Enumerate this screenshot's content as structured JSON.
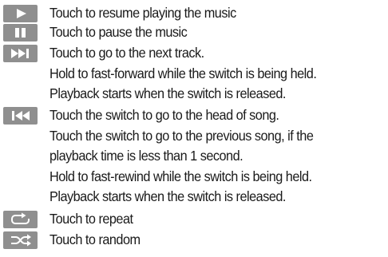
{
  "items": [
    {
      "icon": "play-icon",
      "lines": [
        "Touch to resume playing the music"
      ]
    },
    {
      "icon": "pause-icon",
      "lines": [
        "Touch to pause the music"
      ]
    },
    {
      "icon": "skip-next-icon",
      "lines": [
        "Touch to go to the next track.",
        "Hold to fast-forward while the switch is being held.",
        "Playback starts when the switch is released."
      ]
    },
    {
      "icon": "skip-previous-icon",
      "lines": [
        "Touch the switch to go to the head of song.",
        "Touch the switch to go to the previous song, if the",
        "playback time is less than 1 second.",
        "Hold to fast-rewind while the switch is being held.",
        "Playback starts when the switch is released."
      ]
    },
    {
      "icon": "repeat-icon",
      "lines": [
        "Touch to repeat"
      ]
    },
    {
      "icon": "shuffle-icon",
      "lines": [
        "Touch to random"
      ]
    }
  ],
  "colors": {
    "icon_background": "#8f8f8f",
    "icon_glyph": "#ffffff",
    "text": "#1a1a1a"
  }
}
